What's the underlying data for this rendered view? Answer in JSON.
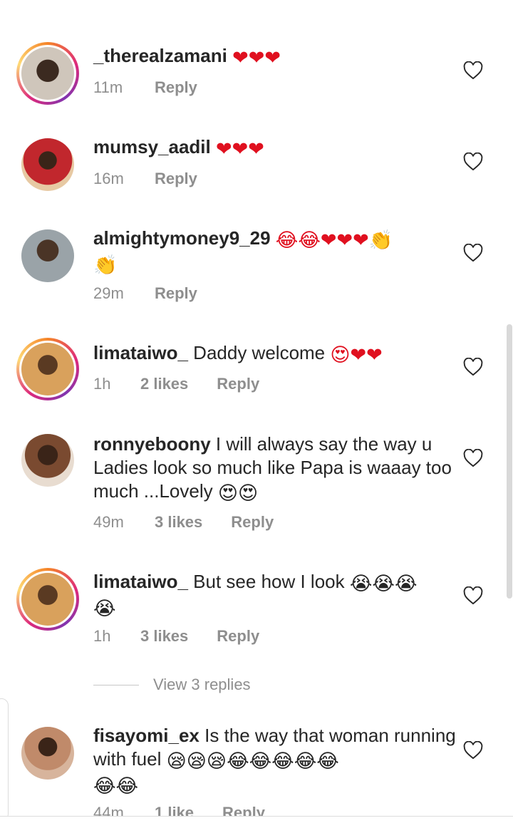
{
  "comments": [
    {
      "username": "_therealzamani",
      "text": "",
      "emoji": "❤❤❤",
      "time": "11m",
      "likes": "",
      "reply": "Reply",
      "story_ring": true,
      "avatar_color": "#5a4632"
    },
    {
      "username": "mumsy_aadil",
      "text": "",
      "emoji": "❤❤❤",
      "time": "16m",
      "likes": "",
      "reply": "Reply",
      "story_ring": false,
      "avatar_color": "#c1272d"
    },
    {
      "username": "almightymoney9_29",
      "text": "",
      "emoji": "😂😂❤❤❤👏",
      "emoji2": "👏",
      "time": "29m",
      "likes": "",
      "reply": "Reply",
      "story_ring": false,
      "avatar_color": "#6b5a4a"
    },
    {
      "username": "limataiwo_",
      "text": "Daddy welcome",
      "emoji": "😍❤❤",
      "time": "1h",
      "likes": "2 likes",
      "reply": "Reply",
      "story_ring": true,
      "avatar_color": "#b07a45"
    },
    {
      "username": "ronnyeboony",
      "text": "I will always say the way u Ladies look so much like Papa is waaay too much ...Lovely",
      "emoji": "😍😍",
      "time": "49m",
      "likes": "3 likes",
      "reply": "Reply",
      "story_ring": false,
      "avatar_color": "#8a5a3c"
    },
    {
      "username": "limataiwo_",
      "text": "But see how I look",
      "emoji": "😭😭😭",
      "emoji2": "😭",
      "time": "1h",
      "likes": "3 likes",
      "reply": "Reply",
      "story_ring": true,
      "avatar_color": "#b07a45"
    },
    {
      "username": "fisayomi_ex",
      "text": "Is the way that woman running with fuel",
      "emoji": "😪😪😪😂😂😂😂😂",
      "emoji2": "😂😂",
      "time": "44m",
      "likes": "1 like",
      "reply": "Reply",
      "story_ring": false,
      "avatar_color": "#9a6a55"
    }
  ],
  "view_replies": "View 3 replies",
  "colors": {
    "heart": "#e0101f",
    "meta": "#8e8e8e",
    "text": "#262626"
  }
}
